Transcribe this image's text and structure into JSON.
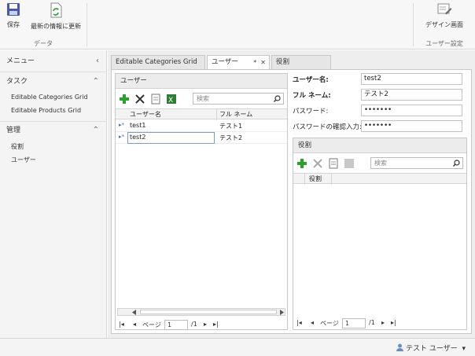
{
  "ribbon": {
    "data_group": {
      "label": "データ",
      "save_label": "保存",
      "refresh_label": "最新の情報に更新"
    },
    "user_settings_group": {
      "label": "ユーザー設定",
      "design_label": "デザイン画面"
    }
  },
  "nav": {
    "menu_label": "メニュー",
    "tasks_label": "タスク",
    "tasks_items": [
      "Editable Categories Grid",
      "Editable Products Grid"
    ],
    "admin_label": "管理",
    "admin_items": [
      "役割",
      "ユーザー"
    ]
  },
  "tabs": [
    {
      "label": "Editable Categories Grid"
    },
    {
      "label": "ユーザー",
      "marker": "*",
      "close": "✕"
    },
    {
      "label": "役割"
    }
  ],
  "users_panel": {
    "title": "ユーザー",
    "search_placeholder": "検索",
    "columns": [
      "ユーザー名",
      "フル ネーム"
    ],
    "rows": [
      {
        "username": "test1",
        "fullname": "テスト1"
      },
      {
        "username": "test2",
        "fullname": "テスト2"
      }
    ],
    "pager": {
      "page_label": "ページ",
      "page_value": "1",
      "total": "/1"
    }
  },
  "details": {
    "username_label": "ユーザー名:",
    "username_value": "test2",
    "fullname_label": "フル ネーム:",
    "fullname_value": "テスト2",
    "password_label": "パスワード:",
    "password_value": "•••••••",
    "confirm_label": "パスワードの確認入力:",
    "confirm_value": "•••••••"
  },
  "roles_panel": {
    "title": "役割",
    "search_placeholder": "検索",
    "columns": [
      "役割"
    ],
    "pager": {
      "page_label": "ページ",
      "page_value": "1",
      "total": "/1"
    }
  },
  "statusbar": {
    "user_name": "テスト ユーザー"
  },
  "colors": {
    "accent": "#3a6fb0",
    "add": "#2e9e2e",
    "delete": "#333333"
  }
}
